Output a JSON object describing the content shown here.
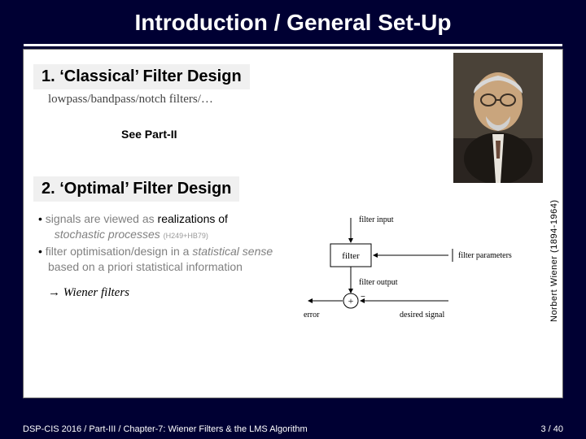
{
  "title": "Introduction / General Set-Up",
  "section1": {
    "heading": "1. ‘Classical’ Filter Design",
    "sub": "lowpass/bandpass/notch filters/…",
    "see": "See Part-II"
  },
  "section2": {
    "heading": "2. ‘Optimal’ Filter Design",
    "bullet1_a": "signals are viewed as ",
    "bullet1_b": "realizations of",
    "bullet1_c": "stochastic processes",
    "bullet1_ref": "(H249+HB79)",
    "bullet2_a": "filter optimisation/design in a ",
    "bullet2_b": "statistical sense",
    "bullet2_c": " based on a priori statistical information",
    "arrow": "→ Wiener filters"
  },
  "diagram": {
    "filter_input": "filter input",
    "filter": "filter",
    "filter_params": "filter parameters",
    "filter_output": "filter output",
    "error": "error",
    "desired": "desired signal"
  },
  "portrait_caption": "Norbert Wiener (1894-1964)",
  "footer": {
    "left": "DSP-CIS 2016  /  Part-III /  Chapter-7: Wiener Filters & the LMS Algorithm",
    "right": "3 / 40"
  }
}
